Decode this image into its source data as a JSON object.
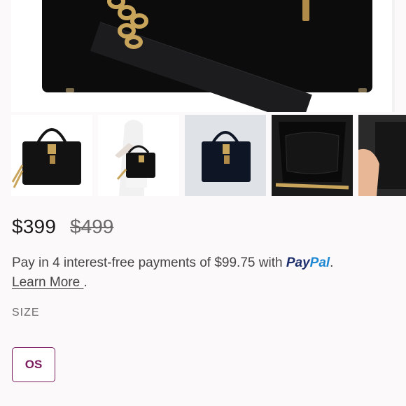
{
  "product": {
    "hero_image": "black-handbag-closeup",
    "thumbnails": [
      {
        "name": "black-satchel-front",
        "selected": true
      },
      {
        "name": "model-holding-bag",
        "selected": false
      },
      {
        "name": "bag-on-grey-background",
        "selected": false
      },
      {
        "name": "bag-interior-lining",
        "selected": false
      },
      {
        "name": "bag-side-with-hand",
        "selected": false
      }
    ]
  },
  "price": {
    "current": "$399",
    "original": "$499"
  },
  "installments": {
    "text": "Pay in 4 interest-free payments of $99.75 with ",
    "paypal_pay": "Pay",
    "paypal_pal": "Pal",
    "period": ".",
    "learn_more": "Learn More ",
    "trailing": "."
  },
  "size": {
    "label": "SIZE",
    "options": [
      "OS"
    ],
    "selected": "OS"
  },
  "colors": {
    "accent": "#7b1d5e",
    "paypal_dark": "#1b2d6b",
    "paypal_light": "#1e88d3"
  }
}
